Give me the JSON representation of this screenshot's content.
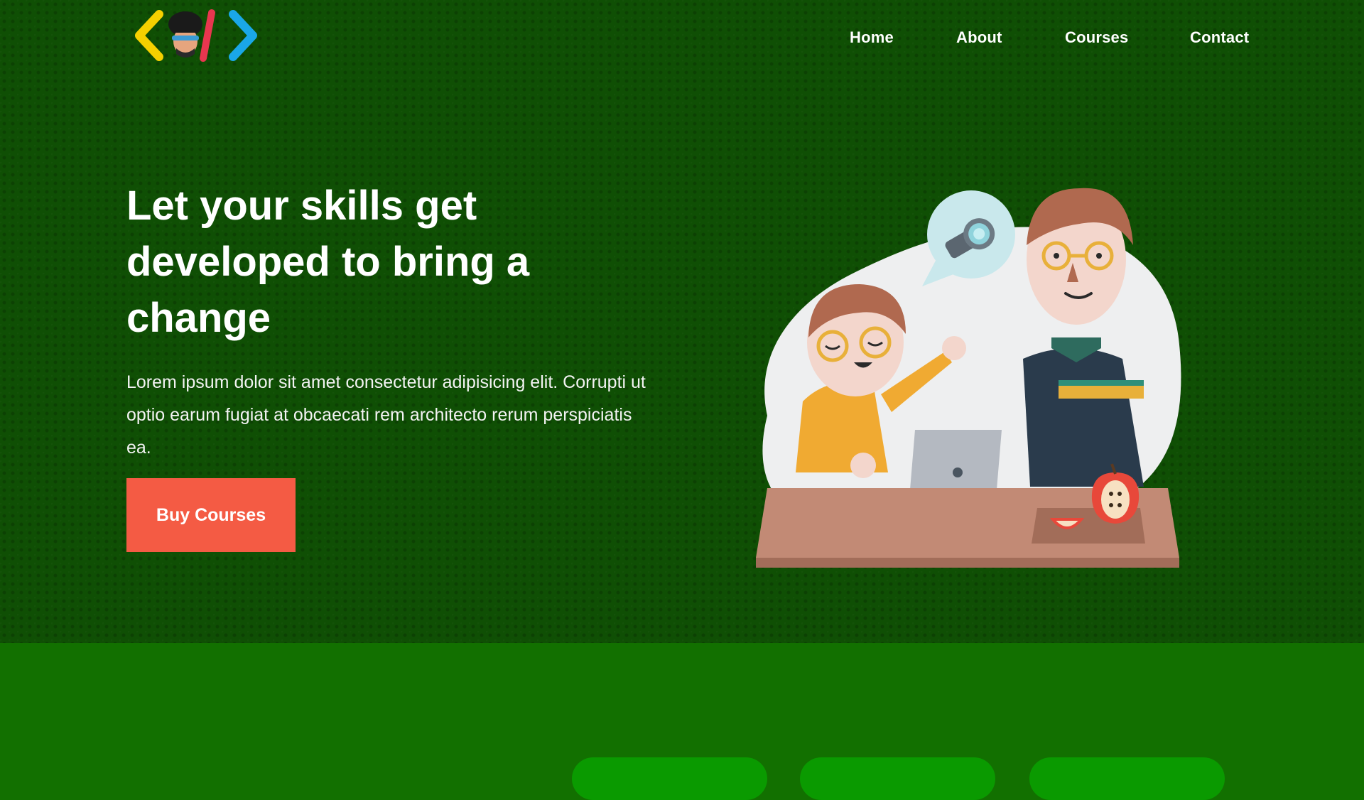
{
  "nav": {
    "items": [
      {
        "label": "Home"
      },
      {
        "label": "About"
      },
      {
        "label": "Courses"
      },
      {
        "label": "Contact"
      }
    ]
  },
  "hero": {
    "headline": "Let your skills get developed to bring a change",
    "description": "Lorem ipsum dolor sit amet consectetur adipisicing elit. Corrupti ut optio earum fugiat at obcaecati rem architecto rerum perspiciatis ea.",
    "cta_label": "Buy Courses"
  },
  "section2": {
    "title": ""
  },
  "icons": {
    "logo": "code-brackets-logo-icon"
  },
  "colors": {
    "hero_bg": "#0f4f04",
    "section_bg": "#127000",
    "cta": "#f45b44",
    "logo_yellow": "#f5d000",
    "logo_red": "#e8364f",
    "logo_blue": "#1aa7e8"
  }
}
